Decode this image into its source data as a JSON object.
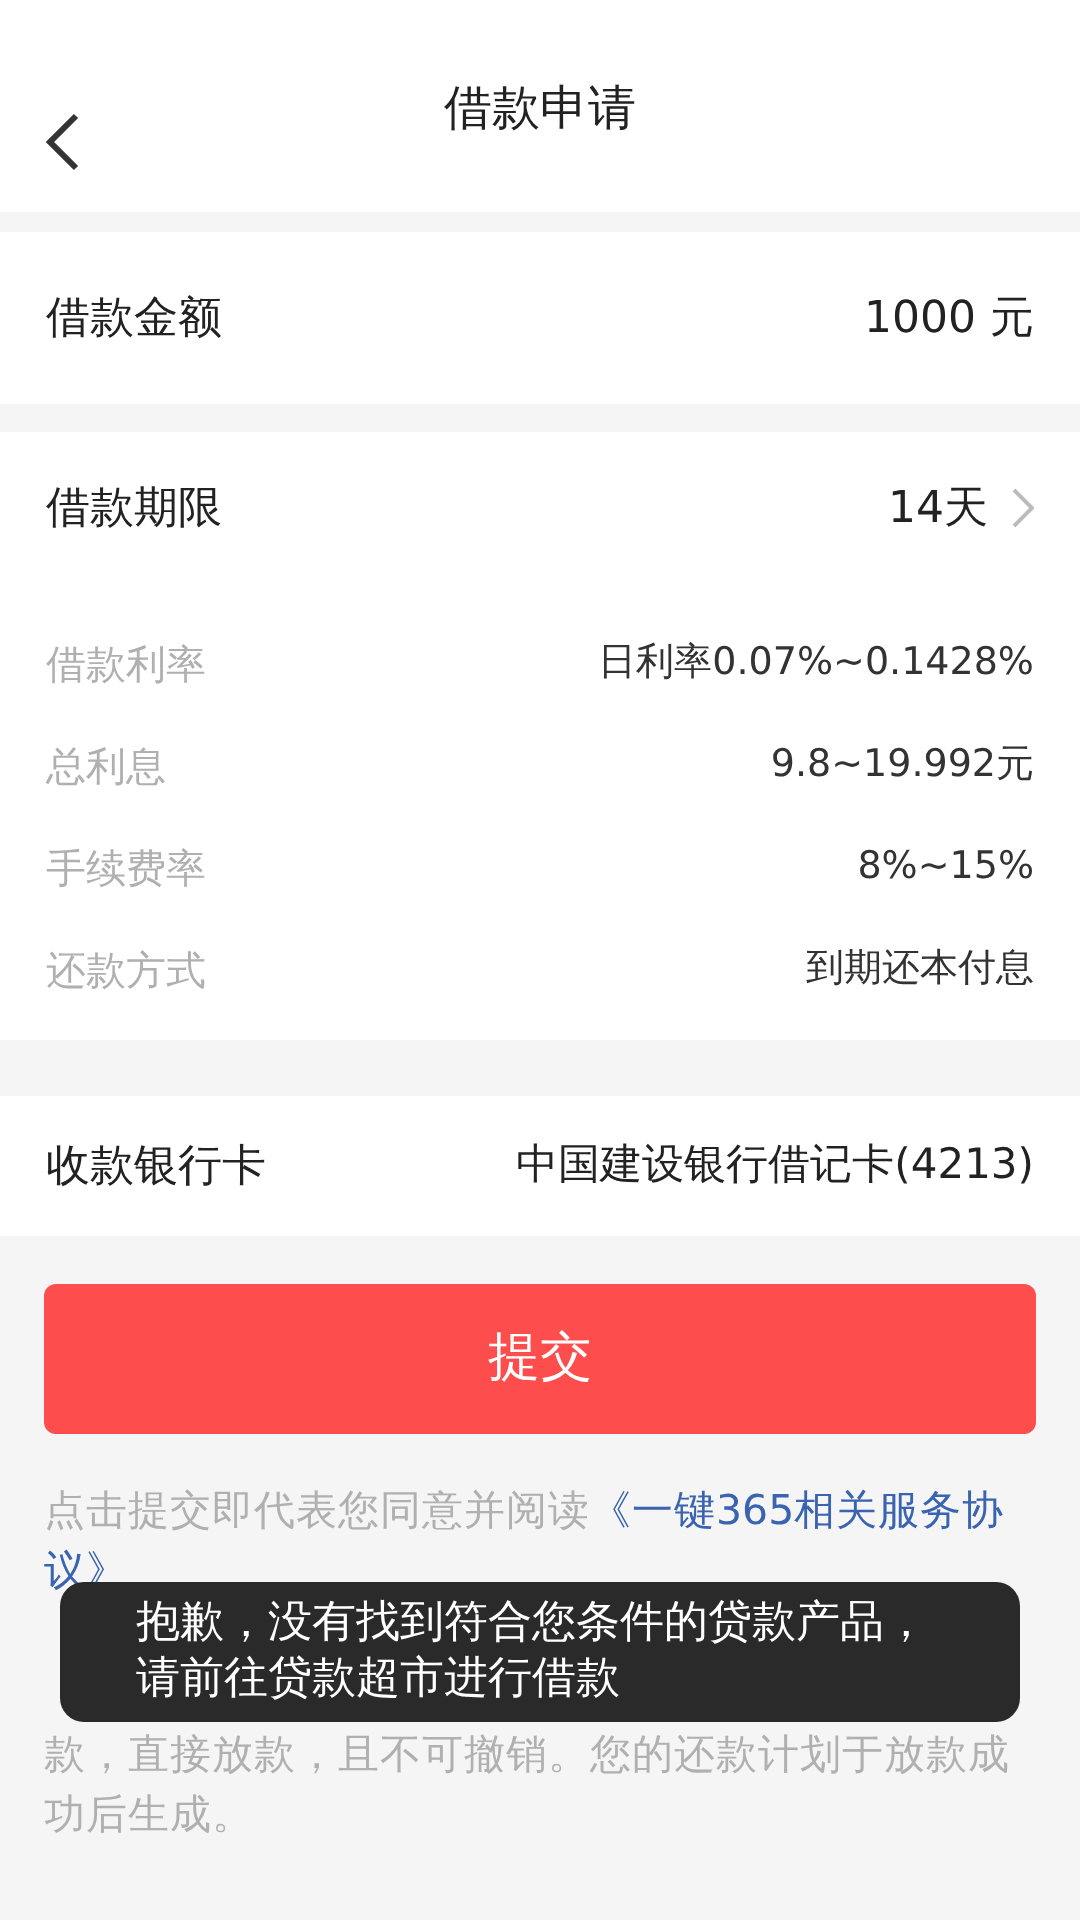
{
  "header": {
    "title": "借款申请"
  },
  "amount": {
    "label": "借款金额",
    "value": "1000 元"
  },
  "term": {
    "label": "借款期限",
    "value": "14天"
  },
  "details": [
    {
      "label": "借款利率",
      "value": "日利率0.07%~0.1428%"
    },
    {
      "label": "总利息",
      "value": "9.8~19.992元"
    },
    {
      "label": "手续费率",
      "value": "8%~15%"
    },
    {
      "label": "还款方式",
      "value": "到期还本付息"
    }
  ],
  "bank": {
    "label": "收款银行卡",
    "value": "中国建设银行借记卡(4213)"
  },
  "submit": "提交",
  "agreement": {
    "prefix": "点击提交即代表您同意并阅读",
    "link": "《一键365相关服务协",
    "link_continued": "议》",
    "tail": "款，直接放款，且不可撤销。您的还款计划于放款成功后生成。"
  },
  "toast": "抱歉，没有找到符合您条件的贷款产品，请前往贷款超市进行借款"
}
